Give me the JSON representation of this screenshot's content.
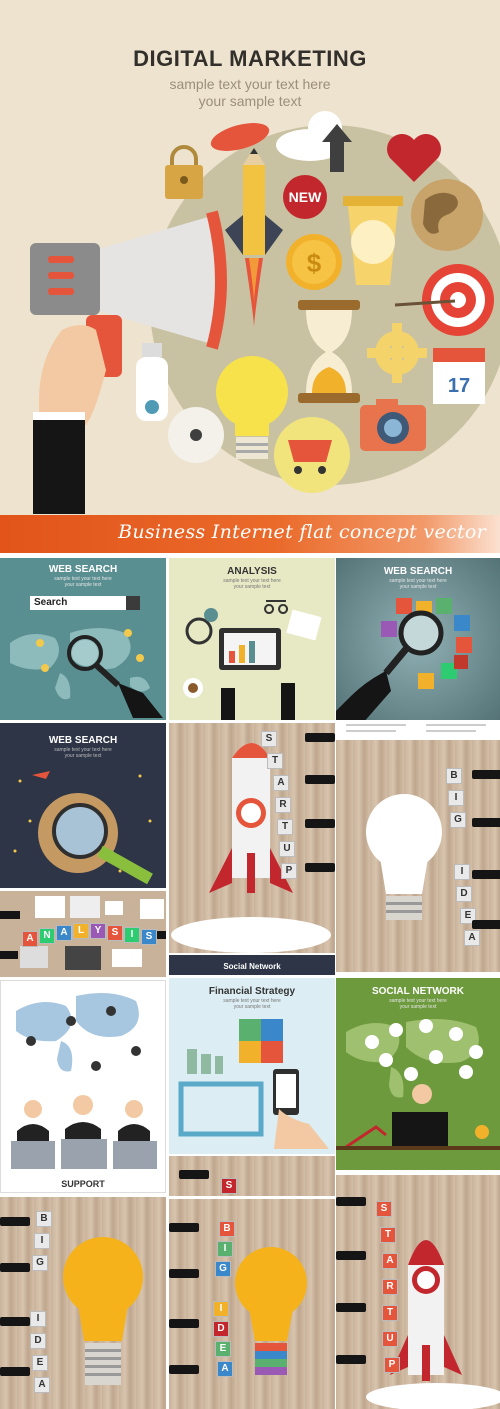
{
  "hero": {
    "title": "DIGITAL MARKETING",
    "subtitle_line1": "sample text your text here",
    "subtitle_line2": "your sample text",
    "new_badge": "NEW",
    "calendar_day": "17"
  },
  "banner": {
    "text": "Business Internet flat concept vector"
  },
  "tiles": {
    "web_search_1": {
      "title": "WEB SEARCH",
      "sub1": "sample text your text here",
      "sub2": "your sample text",
      "search_label": "Search"
    },
    "analysis": {
      "title": "ANALYSIS",
      "sub1": "sample text your text here",
      "sub2": "your sample text"
    },
    "web_search_2": {
      "title": "WEB SEARCH",
      "sub1": "sample text your text here",
      "sub2": "your sample text"
    },
    "web_search_3": {
      "title": "WEB SEARCH",
      "sub1": "sample text your text here",
      "sub2": "your sample text"
    },
    "startup_1": {
      "letters": [
        "S",
        "T",
        "A",
        "R",
        "T",
        "U",
        "P"
      ]
    },
    "big_idea_1": {
      "letters": [
        "B",
        "I",
        "G",
        "I",
        "D",
        "E",
        "A"
      ]
    },
    "analysis_photo": {
      "letters": [
        "A",
        "N",
        "A",
        "L",
        "Y",
        "S",
        "I",
        "S"
      ]
    },
    "social_network_strip": {
      "text": "Social Network"
    },
    "support": {
      "label": "SUPPORT"
    },
    "financial_strategy": {
      "title": "Financial Strategy",
      "sub1": "sample text your text here",
      "sub2": "your sample text"
    },
    "social_network": {
      "title": "SOCIAL NETWORK",
      "sub1": "sample text your text here",
      "sub2": "your sample text"
    },
    "wood_strip_letter": "S",
    "big_idea_2": {
      "letters": [
        "B",
        "I",
        "G",
        "I",
        "D",
        "E",
        "A"
      ]
    },
    "big_idea_3": {
      "letters": [
        "B",
        "I",
        "G",
        "I",
        "D",
        "E",
        "A"
      ]
    },
    "startup_2": {
      "letters": [
        "S",
        "T",
        "A",
        "R",
        "T",
        "U",
        "P"
      ]
    }
  },
  "colors": {
    "hero_bg": "#ede3cf",
    "banner_orange": "#e2541a",
    "teal": "#5a8f91",
    "navy": "#2e3a4f",
    "green": "#6d9a3d",
    "bulb_yellow": "#f5b21b"
  }
}
